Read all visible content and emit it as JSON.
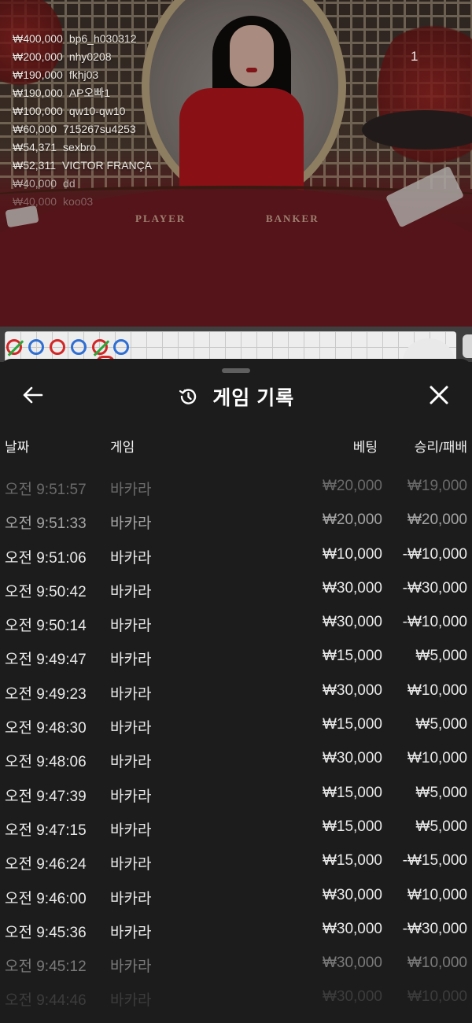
{
  "live": {
    "round_number": "1",
    "table_zones": {
      "player": "PLAYER",
      "banker": "BANKER"
    },
    "winners": [
      {
        "amount": "₩400,000",
        "name": "bp6_h030312"
      },
      {
        "amount": "₩200,000",
        "name": "nhy0208"
      },
      {
        "amount": "₩190,000",
        "name": "fkhj03"
      },
      {
        "amount": "₩190,000",
        "name": "AP오빠1"
      },
      {
        "amount": "₩100,000",
        "name": "qw10-qw10"
      },
      {
        "amount": "₩60,000",
        "name": "715267su4253"
      },
      {
        "amount": "₩54,371",
        "name": "sexbro"
      },
      {
        "amount": "₩52,311",
        "name": "VICTOR FRANÇA"
      },
      {
        "amount": "₩40,000",
        "name": "dd"
      },
      {
        "amount": "₩40,000",
        "name": "koo03"
      }
    ]
  },
  "roadmap": {
    "beads": [
      "banker-tie",
      "player",
      "banker",
      "player",
      "banker-tie",
      "player"
    ],
    "colors": {
      "banker": "#d32626",
      "player": "#2f6fd4",
      "tie": "#2aa83a"
    }
  },
  "history": {
    "title": "게임 기록",
    "icons": {
      "back": "arrow-left-icon",
      "title": "history-clock-icon",
      "close": "close-icon"
    },
    "columns": {
      "date": "날짜",
      "game": "게임",
      "bet": "베팅",
      "win_loss": "승리/패배"
    },
    "rows": [
      {
        "time": "오전 9:51:57",
        "game": "바카라",
        "bet": "₩20,000",
        "result": "₩19,000"
      },
      {
        "time": "오전 9:51:33",
        "game": "바카라",
        "bet": "₩20,000",
        "result": "₩20,000"
      },
      {
        "time": "오전 9:51:06",
        "game": "바카라",
        "bet": "₩10,000",
        "result": "-₩10,000"
      },
      {
        "time": "오전 9:50:42",
        "game": "바카라",
        "bet": "₩30,000",
        "result": "-₩30,000"
      },
      {
        "time": "오전 9:50:14",
        "game": "바카라",
        "bet": "₩30,000",
        "result": "-₩10,000"
      },
      {
        "time": "오전 9:49:47",
        "game": "바카라",
        "bet": "₩15,000",
        "result": "₩5,000"
      },
      {
        "time": "오전 9:49:23",
        "game": "바카라",
        "bet": "₩30,000",
        "result": "₩10,000"
      },
      {
        "time": "오전 9:48:30",
        "game": "바카라",
        "bet": "₩15,000",
        "result": "₩5,000"
      },
      {
        "time": "오전 9:48:06",
        "game": "바카라",
        "bet": "₩30,000",
        "result": "₩10,000"
      },
      {
        "time": "오전 9:47:39",
        "game": "바카라",
        "bet": "₩15,000",
        "result": "₩5,000"
      },
      {
        "time": "오전 9:47:15",
        "game": "바카라",
        "bet": "₩15,000",
        "result": "₩5,000"
      },
      {
        "time": "오전 9:46:24",
        "game": "바카라",
        "bet": "₩15,000",
        "result": "-₩15,000"
      },
      {
        "time": "오전 9:46:00",
        "game": "바카라",
        "bet": "₩30,000",
        "result": "₩10,000"
      },
      {
        "time": "오전 9:45:36",
        "game": "바카라",
        "bet": "₩30,000",
        "result": "-₩30,000"
      },
      {
        "time": "오전 9:45:12",
        "game": "바카라",
        "bet": "₩30,000",
        "result": "₩10,000"
      },
      {
        "time": "오전 9:44:46",
        "game": "바카라",
        "bet": "₩30,000",
        "result": "₩10,000"
      }
    ]
  }
}
